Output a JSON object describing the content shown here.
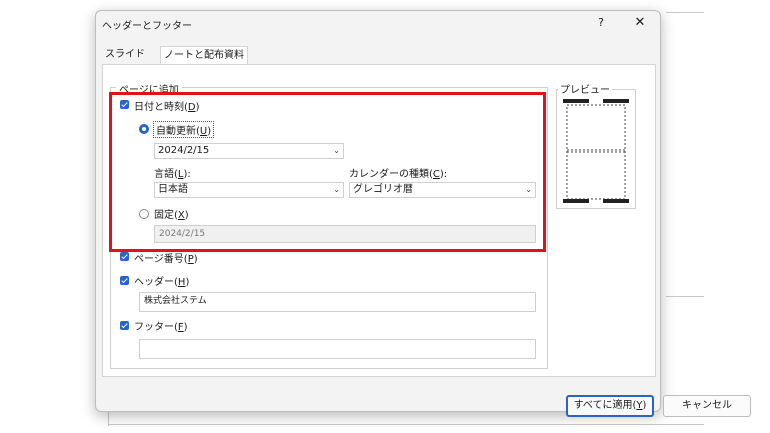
{
  "dialog": {
    "title": "ヘッダーとフッター",
    "help_label": "?",
    "close_label": "✕"
  },
  "tabs": [
    {
      "label": "スライド"
    },
    {
      "label": "ノートと配布資料"
    }
  ],
  "page_add": {
    "legend": "ページに追加",
    "date_time": {
      "label": "日付と時刻(",
      "mnemonic": "D",
      "suffix": ")",
      "checked": true
    },
    "auto_update": {
      "label": "自動更新(",
      "mnemonic": "U",
      "suffix": ")",
      "selected": true
    },
    "date_value": "2024/2/15",
    "language": {
      "label": "言語(",
      "mnemonic": "L",
      "suffix": "):",
      "value": "日本語"
    },
    "calendar": {
      "label": "カレンダーの種類(",
      "mnemonic": "C",
      "suffix": "):",
      "value": "グレゴリオ暦"
    },
    "fixed": {
      "label": "固定(",
      "mnemonic": "X",
      "suffix": ")",
      "selected": false
    },
    "fixed_value": "2024/2/15",
    "page_number": {
      "label": "ページ番号(",
      "mnemonic": "P",
      "suffix": ")",
      "checked": true
    },
    "header": {
      "label": "ヘッダー(",
      "mnemonic": "H",
      "suffix": ")",
      "checked": true,
      "value": "株式会社ステム"
    },
    "footer": {
      "label": "フッター(",
      "mnemonic": "F",
      "suffix": ")",
      "checked": true,
      "value": ""
    }
  },
  "preview": {
    "legend": "プレビュー"
  },
  "buttons": {
    "apply": {
      "label": "すべてに適用(",
      "mnemonic": "Y",
      "suffix": ")"
    },
    "cancel": "キャンセル"
  },
  "colors": {
    "accent": "#2a64c5",
    "highlight": "#e0131b"
  }
}
